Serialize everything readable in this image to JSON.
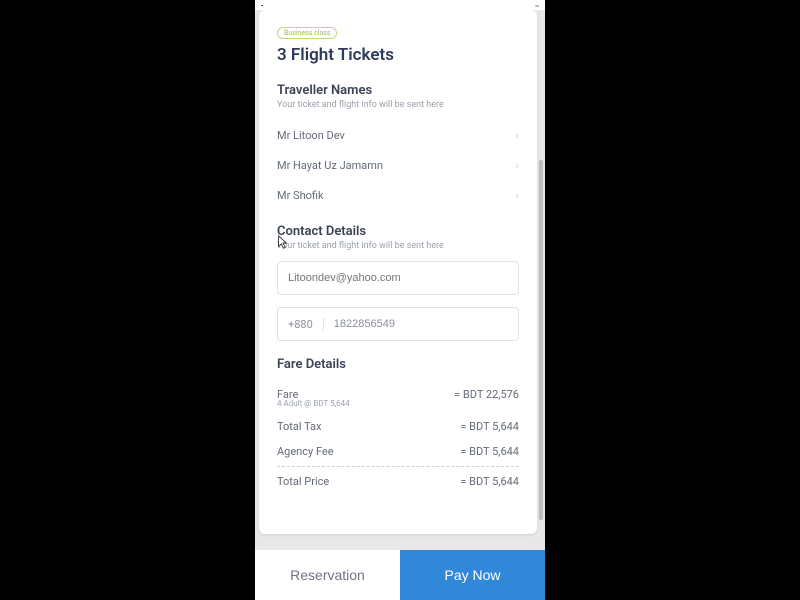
{
  "badge": "Business class",
  "title": "3 Flight Tickets",
  "travellers": {
    "heading": "Traveller Names",
    "sub": "Your ticket and flight info will be sent here",
    "items": [
      {
        "name": "Mr Litoon Dev"
      },
      {
        "name": "Mr Hayat Uz Jamamn"
      },
      {
        "name": "Mr Shofik"
      }
    ]
  },
  "contact": {
    "heading": "Contact Details",
    "sub": "Your ticket and flight info will be sent here",
    "email_placeholder": "Litoondev@yahoo.com",
    "phone_cc": "+880",
    "phone_number": "1822856549"
  },
  "fare": {
    "heading": "Fare Details",
    "rows": [
      {
        "label": "Fare",
        "value": "= BDT 22,576",
        "sub": "4 Adult @ BDT 5,644"
      },
      {
        "label": "Total Tax",
        "value": "= BDT 5,644"
      },
      {
        "label": "Agency Fee",
        "value": "= BDT 5,644"
      }
    ],
    "total": {
      "label": "Total Price",
      "value": "= BDT 5,644"
    }
  },
  "footer": {
    "reservation": "Reservation",
    "pay": "Pay Now"
  }
}
